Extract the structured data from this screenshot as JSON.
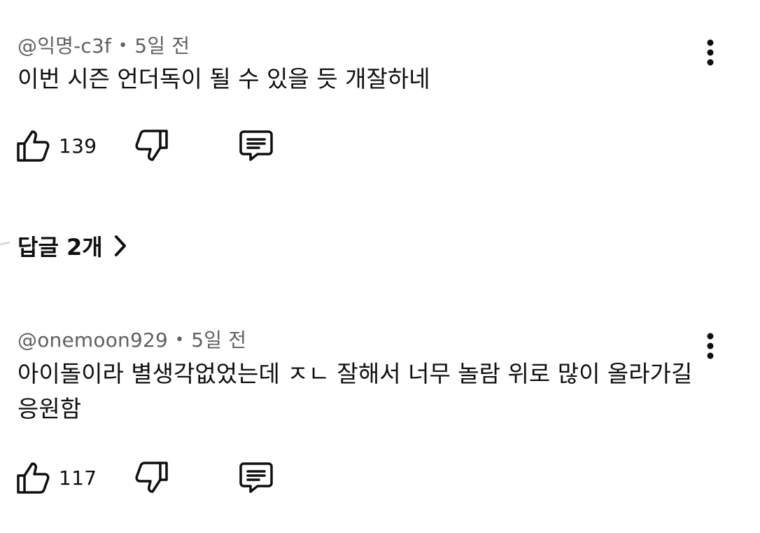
{
  "comments": [
    {
      "author": "@익명-c3f",
      "time": "5일 전",
      "text": "이번 시즌 언더독이 될 수 있을 듯 개잘하네",
      "likes": "139"
    },
    {
      "author": "@onemoon929",
      "time": "5일 전",
      "text": "아이돌이라 별생각없었는데 ㅈㄴ 잘해서 너무 놀람 위로 많이 올라가길 응원함",
      "likes": "117"
    }
  ],
  "replies": {
    "label": "답글 2개"
  },
  "icons": {
    "like": "thumb-up-icon",
    "dislike": "thumb-down-icon",
    "reply": "comment-icon",
    "more": "more-vert-icon",
    "chevron": "chevron-right-icon"
  }
}
